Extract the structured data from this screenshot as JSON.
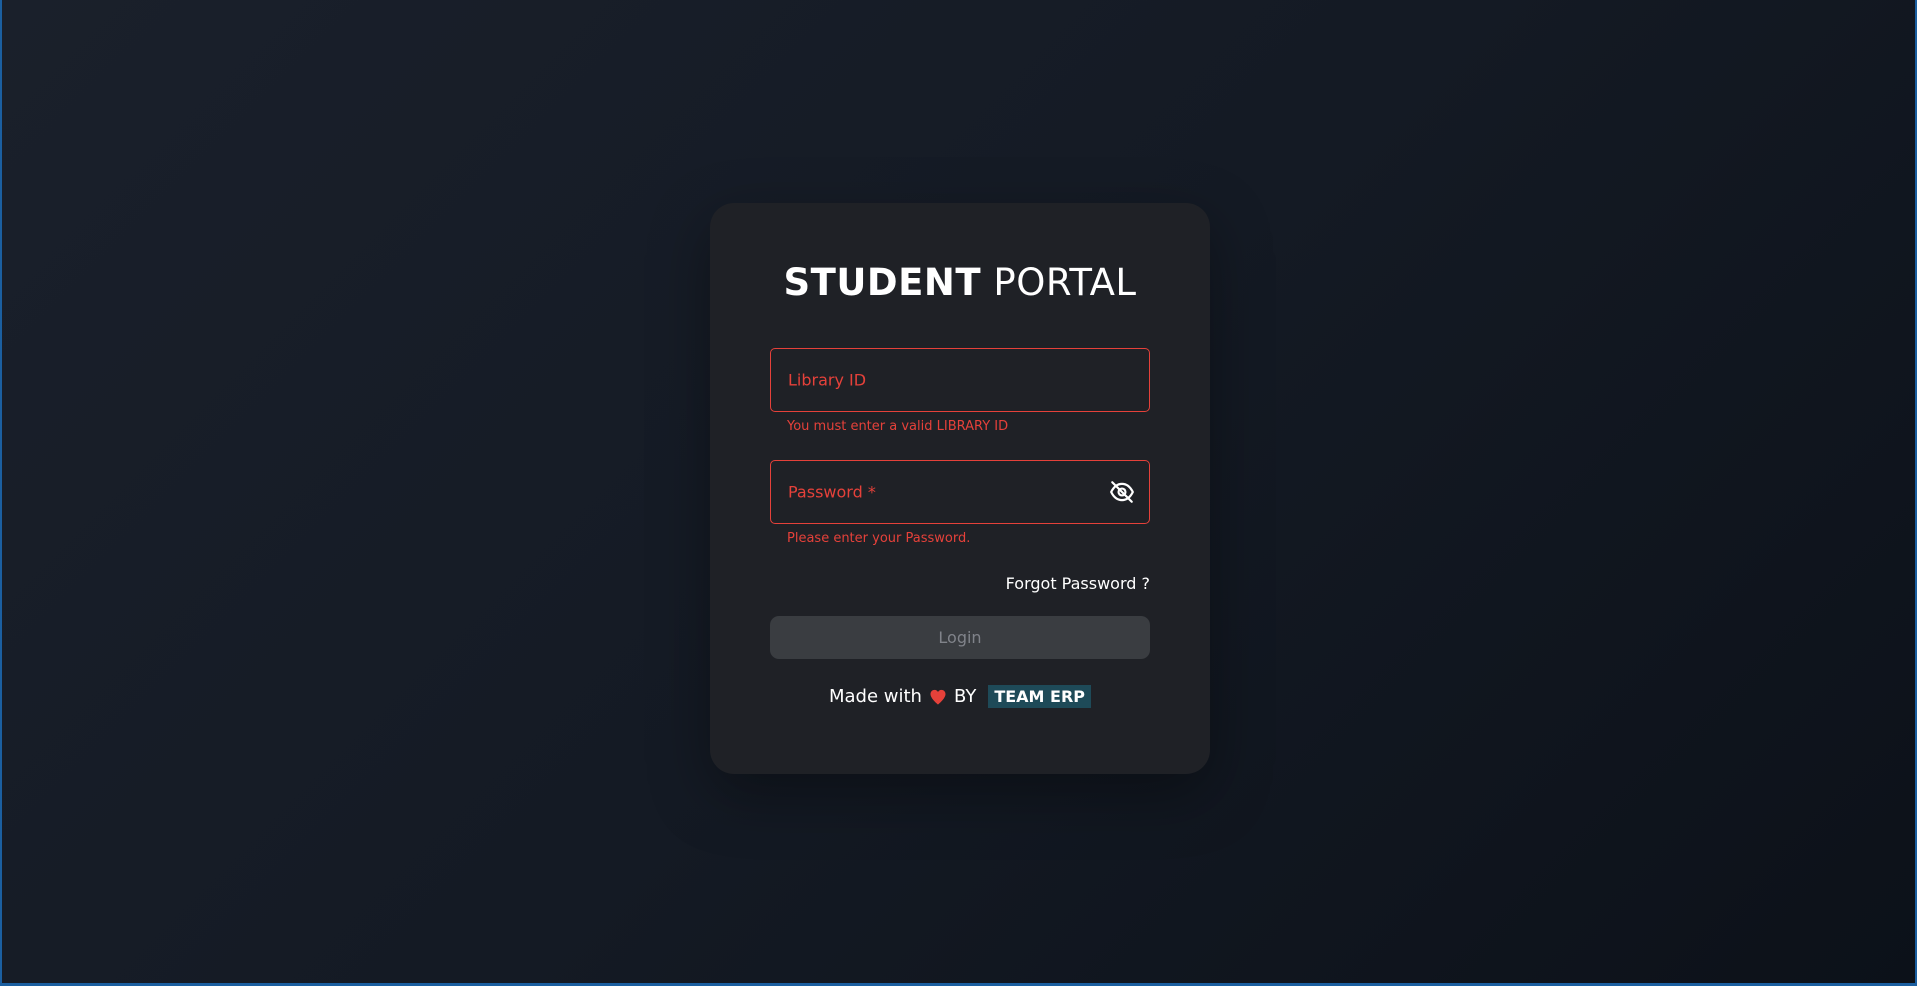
{
  "title": {
    "bold": "STUDENT",
    "light": "PORTAL"
  },
  "form": {
    "library_id": {
      "placeholder": "Library ID",
      "value": "",
      "error": "You must enter a valid LIBRARY ID"
    },
    "password": {
      "placeholder": "Password *",
      "value": "",
      "error": "Please enter your Password.",
      "toggle_icon": "eye-off-icon"
    },
    "forgot_label": "Forgot Password ?",
    "login_label": "Login"
  },
  "footer": {
    "made_with": "Made with",
    "heart_icon": "heart-icon",
    "by": "BY",
    "team": "TEAM ERP"
  },
  "colors": {
    "error": "#e5413a",
    "card_bg": "#1f2126",
    "button_disabled": "#3a3d41",
    "badge_bg": "#1e4a58",
    "heart": "#e5413a"
  }
}
